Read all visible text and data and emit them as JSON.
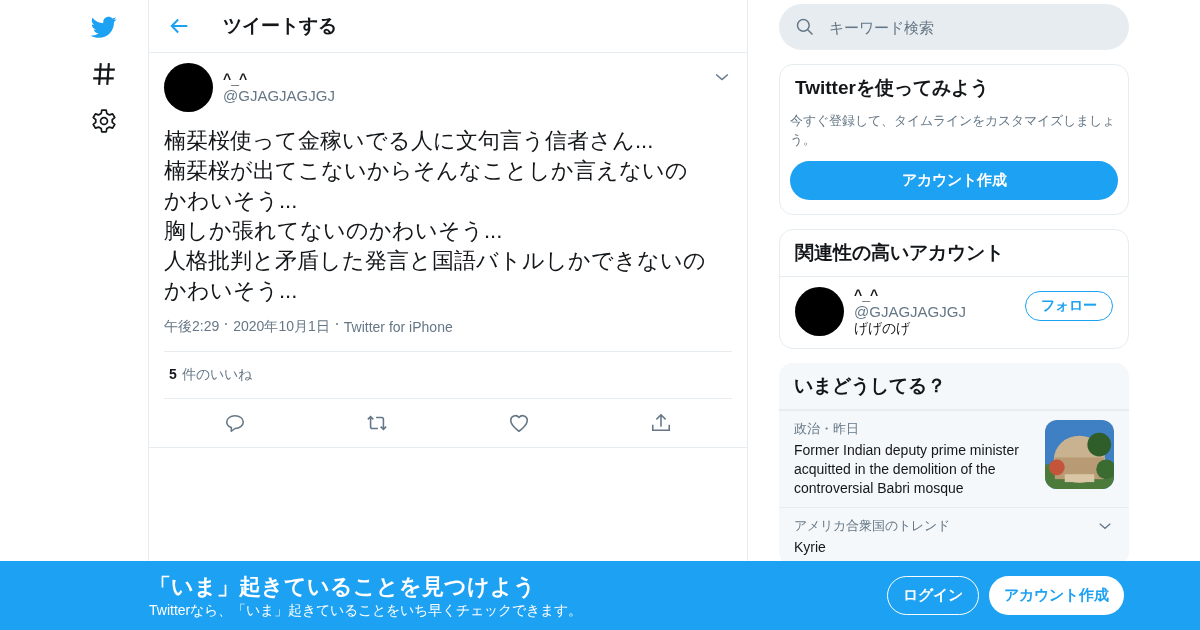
{
  "nav": {
    "items": [
      {
        "kind": "logo"
      },
      {
        "kind": "explore"
      },
      {
        "kind": "settings"
      }
    ]
  },
  "header": {
    "title": "ツイートする"
  },
  "tweet": {
    "name": "^_^",
    "handle": "@GJAGJAGJGJ",
    "lines": [
      "楠栞桜使って金稼いでる人に文句言う信者さん...",
      "楠栞桜が出てこないからそんなことしか言えないの",
      "かわいそう...",
      "胸しか張れてないのかわいそう...",
      "人格批判と矛盾した発言と国語バトルしかできないの",
      "かわいそう..."
    ],
    "time": "午後2:29",
    "date": "2020年10月1日",
    "source": "Twitter for iPhone",
    "like_count": "5",
    "like_label": "件のいいね",
    "actions": [
      {
        "kind": "reply"
      },
      {
        "kind": "retweet"
      },
      {
        "kind": "like"
      },
      {
        "kind": "share"
      }
    ]
  },
  "search": {
    "placeholder": "キーワード検索"
  },
  "signup_card": {
    "title": "Twitterを使ってみよう",
    "text": "今すぐ登録して、タイムラインをカスタマイズしましょう。",
    "button": "アカウント作成"
  },
  "related": {
    "title": "関連性の高いアカウント",
    "accounts": [
      {
        "name": "^_^",
        "handle": "@GJAGJAGJGJ",
        "bio": "げげのげ",
        "button": "フォロー"
      }
    ]
  },
  "trends": {
    "title": "いまどうしてる？",
    "items": [
      {
        "kind": "news",
        "meta": "政治・昨日",
        "headline": "Former Indian deputy prime minister acquitted in the demolition of the controversial Babri mosque"
      },
      {
        "kind": "trend",
        "meta": "アメリカ合衆国のトレンド",
        "headline": "Kyrie"
      }
    ]
  },
  "banner": {
    "title": "「いま」起きていることを見つけよう",
    "subtitle": "Twitterなら、「いま」起きていることをいち早くチェックできます。",
    "login": "ログイン",
    "signup": "アカウント作成"
  }
}
